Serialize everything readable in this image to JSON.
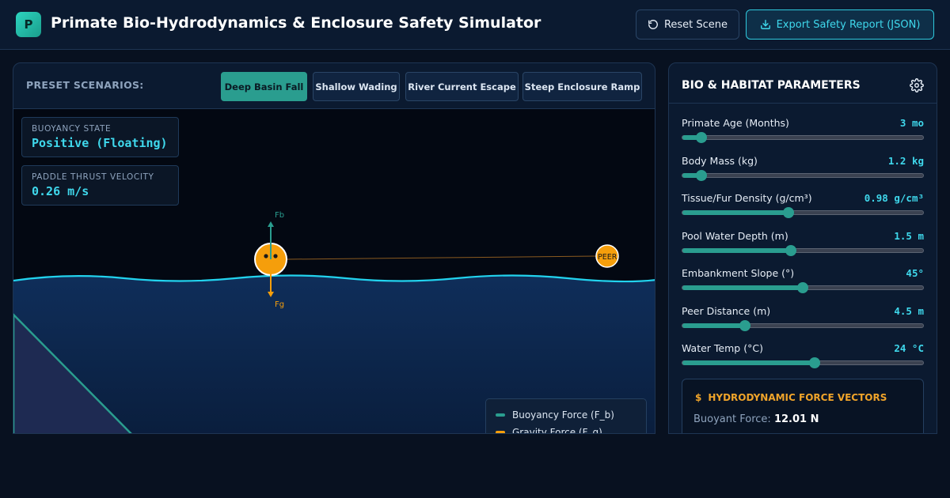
{
  "app": {
    "logo_letter": "P",
    "title": "Primate Bio-Hydrodynamics & Enclosure Safety Simulator",
    "reset_label": "Reset Scene",
    "export_label": "Export Safety Report (JSON)"
  },
  "presets": {
    "label": "PRESET SCENARIOS:",
    "items": [
      {
        "label": "Deep Basin Fall",
        "active": true
      },
      {
        "label": "Shallow Wading",
        "active": false
      },
      {
        "label": "River Current Escape",
        "active": false
      },
      {
        "label": "Steep Enclosure Ramp",
        "active": false
      }
    ]
  },
  "readouts": {
    "buoyancy_label": "BUOYANCY STATE",
    "buoyancy_value": "Positive (Floating)",
    "thrust_label": "PADDLE THRUST VELOCITY",
    "thrust_value": "0.26 m/s"
  },
  "scene": {
    "fb_label": "Fb",
    "fg_label": "Fg",
    "peer_label": "PEER",
    "water_color": "#0f2e5a",
    "wave_color": "#22d3ee",
    "primate_color": "#f59e0b"
  },
  "legend": {
    "items": [
      {
        "label": "Buoyancy Force (F_b)",
        "color": "#2a9d8f"
      },
      {
        "label": "Gravity Force (F_g)",
        "color": "#f59e0b"
      }
    ]
  },
  "params": {
    "title": "BIO & HABITAT PARAMETERS",
    "items": [
      {
        "label": "Primate Age (Months)",
        "value": "3 mo",
        "fraction": 0.08
      },
      {
        "label": "Body Mass (kg)",
        "value": "1.2 kg",
        "fraction": 0.08
      },
      {
        "label": "Tissue/Fur Density (g/cm³)",
        "value": "0.98 g/cm³",
        "fraction": 0.44
      },
      {
        "label": "Pool Water Depth (m)",
        "value": "1.5 m",
        "fraction": 0.45
      },
      {
        "label": "Embankment Slope (°)",
        "value": "45°",
        "fraction": 0.5
      },
      {
        "label": "Peer Distance (m)",
        "value": "4.5 m",
        "fraction": 0.26
      },
      {
        "label": "Water Temp (°C)",
        "value": "24 °C",
        "fraction": 0.55
      }
    ]
  },
  "forces": {
    "title": "HYDRODYNAMIC FORCE VECTORS",
    "buoyant_label": "Buoyant Force:",
    "buoyant_value": "12.01 N"
  }
}
